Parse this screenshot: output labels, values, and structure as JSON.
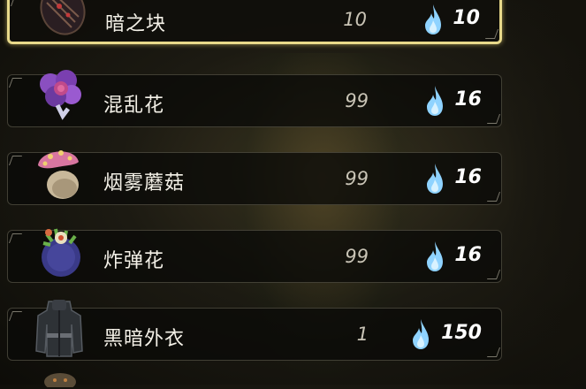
{
  "colors": {
    "selection_border": "#e8d98a",
    "spirit_blue": "#8fd3ff",
    "row_background": "#0a0a08"
  },
  "items": [
    {
      "name": "暗之块",
      "quantity": "10",
      "price": "10",
      "icon": "dark-lump-icon",
      "selected": true
    },
    {
      "name": "混乱花",
      "quantity": "99",
      "price": "16",
      "icon": "muddle-bud-icon",
      "selected": false
    },
    {
      "name": "烟雾蘑菇",
      "quantity": "99",
      "price": "16",
      "icon": "smoke-shroom-icon",
      "selected": false
    },
    {
      "name": "炸弹花",
      "quantity": "99",
      "price": "16",
      "icon": "bomb-flower-icon",
      "selected": false
    },
    {
      "name": "黑暗外衣",
      "quantity": "1",
      "price": "150",
      "icon": "dark-tunic-icon",
      "selected": false
    }
  ]
}
